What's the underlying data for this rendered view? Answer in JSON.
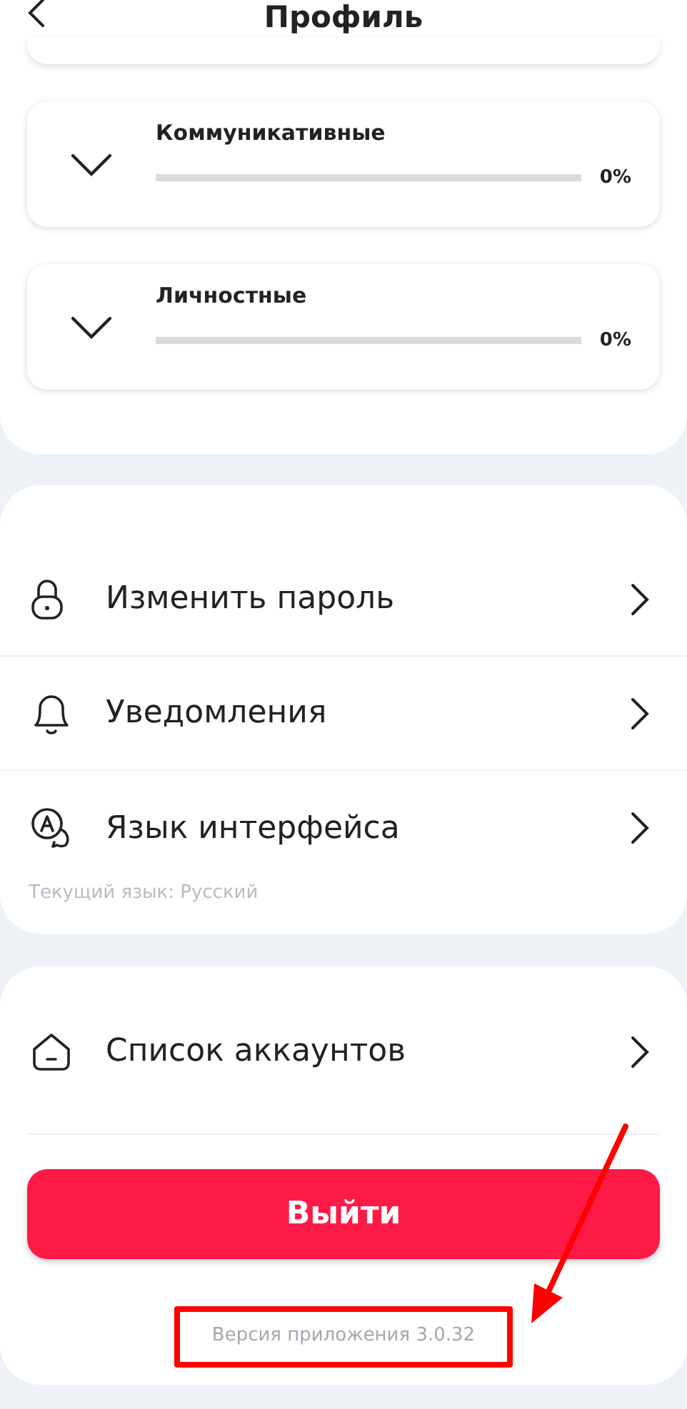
{
  "header": {
    "title": "Профиль"
  },
  "skills": [
    {
      "title": "Коммуникативные",
      "level": 0,
      "percent": "0%"
    },
    {
      "title": "Личностные",
      "level": 0,
      "percent": "0%"
    }
  ],
  "settings": [
    {
      "kind": "lock",
      "label": "Изменить пароль"
    },
    {
      "kind": "bell",
      "label": "Уведомления"
    },
    {
      "kind": "language",
      "label": "Язык интерфейса",
      "note": "Текущий язык:  Русский"
    }
  ],
  "accounts": {
    "kind": "home",
    "label": "Список аккаунтов"
  },
  "logout_button": "Выйти",
  "version": "Версия приложения 3.0.32"
}
